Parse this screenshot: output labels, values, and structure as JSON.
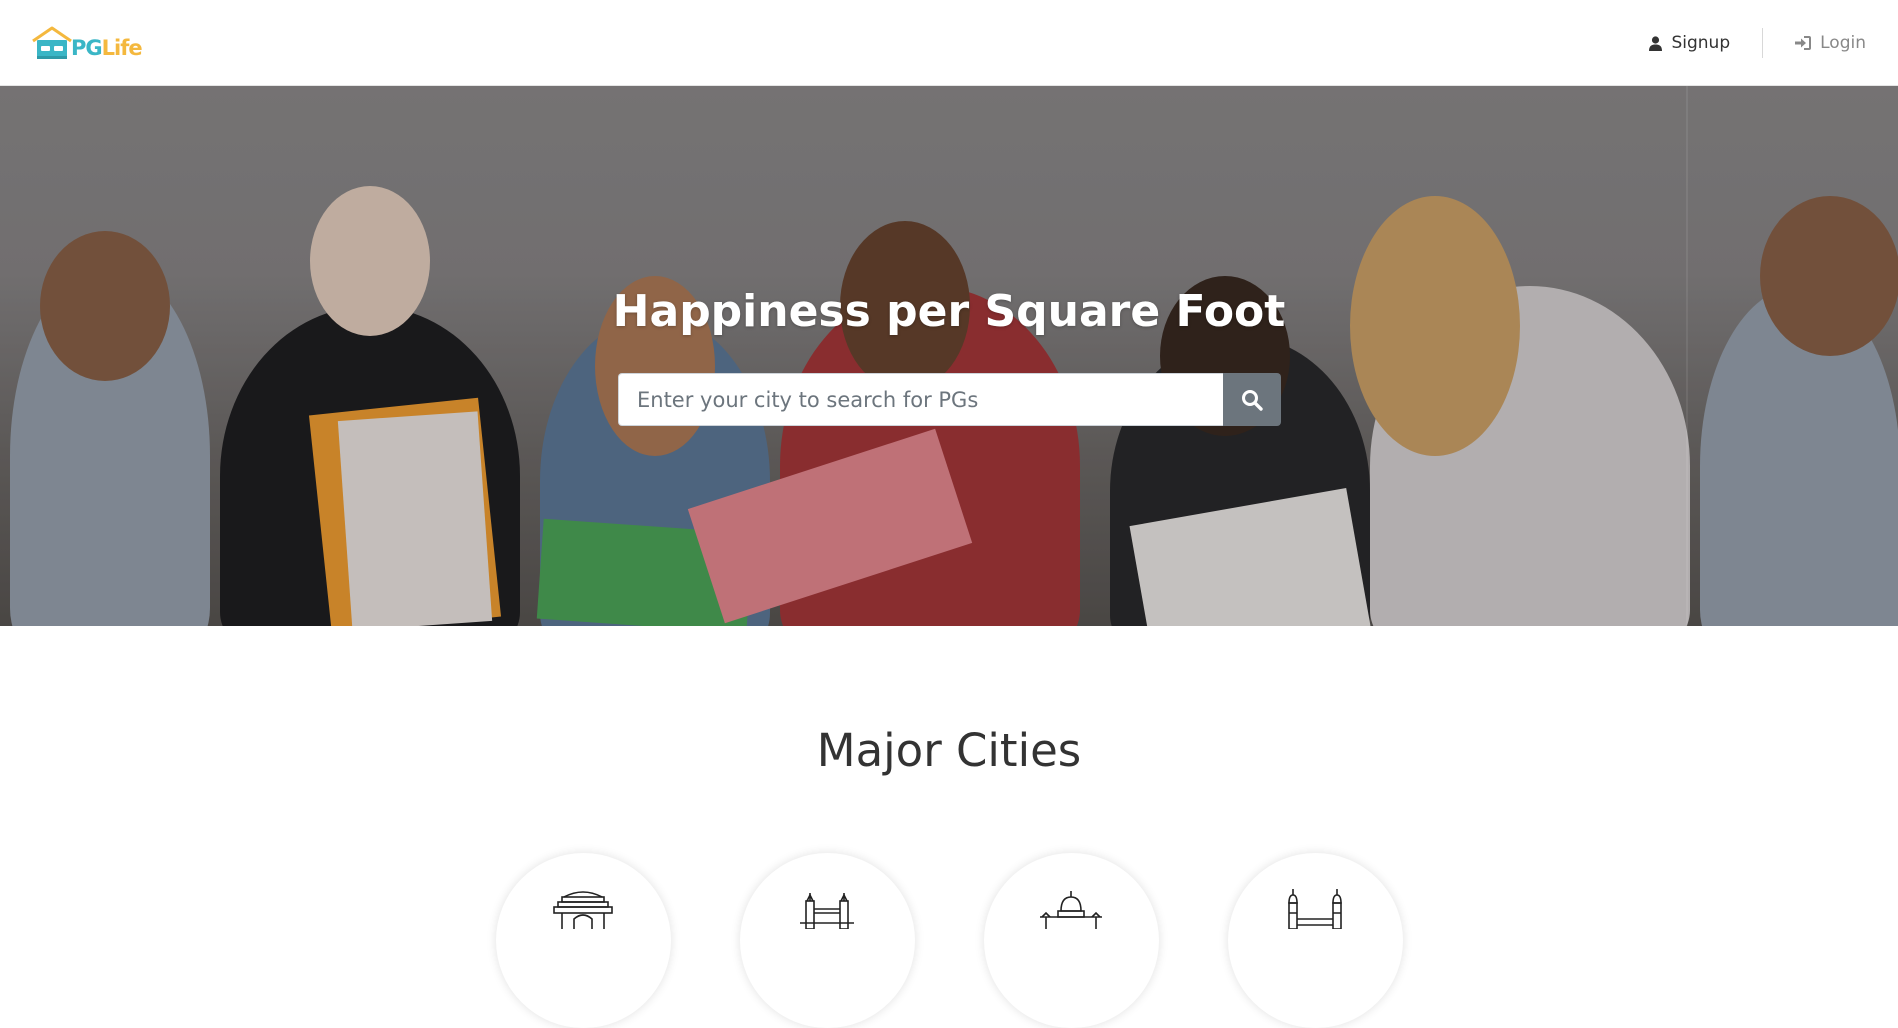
{
  "brand": {
    "name_part1": "PG",
    "name_part2": "Life",
    "primary_color": "#3ab6c6",
    "secondary_color": "#f4b83e"
  },
  "nav": {
    "signup_label": "Signup",
    "signup_icon": "user-icon",
    "login_label": "Login",
    "login_icon": "sign-in-icon"
  },
  "hero": {
    "title": "Happiness per Square Foot",
    "search_placeholder": "Enter your city to search for PGs",
    "search_icon": "search-icon"
  },
  "cities": {
    "title": "Major Cities",
    "items": [
      {
        "icon": "delhi-monument-icon"
      },
      {
        "icon": "mumbai-bridge-icon"
      },
      {
        "icon": "bengaluru-dome-icon"
      },
      {
        "icon": "hyderabad-charminar-icon"
      }
    ]
  },
  "colors": {
    "search_button": "#6c757d",
    "title_text": "#ffffff"
  }
}
